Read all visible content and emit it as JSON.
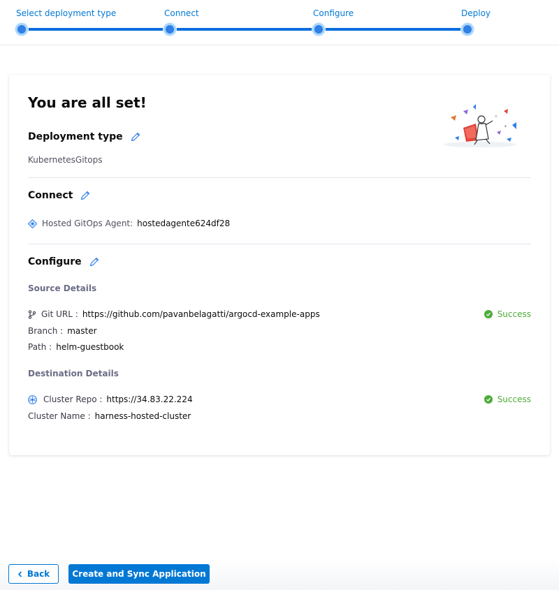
{
  "stepper": {
    "steps": [
      {
        "label": "Select deployment type"
      },
      {
        "label": "Connect"
      },
      {
        "label": "Configure"
      },
      {
        "label": "Deploy"
      }
    ]
  },
  "summary": {
    "title": "You are all set!",
    "deployment_type": {
      "heading": "Deployment type",
      "value": "KubernetesGitops"
    },
    "connect": {
      "heading": "Connect",
      "agent_label": "Hosted GitOps Agent:",
      "agent_value": "hostedagente624df28"
    },
    "configure": {
      "heading": "Configure",
      "source": {
        "heading": "Source Details",
        "git_url_label": "Git URL :",
        "git_url_value": "https://github.com/pavanbelagatti/argocd-example-apps",
        "branch_label": "Branch :",
        "branch_value": "master",
        "path_label": "Path :",
        "path_value": "helm-guestbook",
        "status": "Success"
      },
      "destination": {
        "heading": "Destination Details",
        "cluster_repo_label": "Cluster Repo :",
        "cluster_repo_value": "https://34.83.22.224",
        "cluster_name_label": "Cluster Name :",
        "cluster_name_value": "harness-hosted-cluster",
        "status": "Success"
      }
    }
  },
  "footer": {
    "back_label": "Back",
    "primary_label": "Create and Sync Application"
  },
  "colors": {
    "accent": "#0278d5",
    "success": "#4dab3a"
  }
}
